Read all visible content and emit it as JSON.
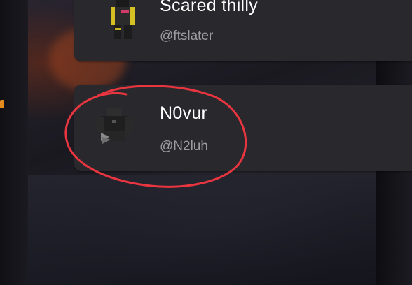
{
  "users": [
    {
      "display_name": "Scared thilly",
      "handle": "@ftslater",
      "avatar_icon": "avatar-figure-icon"
    },
    {
      "display_name": "N0vur",
      "handle": "@N2luh",
      "avatar_icon": "avatar-figure-icon"
    }
  ],
  "colors": {
    "card_background": "#29292d",
    "name_text": "#ffffff",
    "handle_text": "#9c9ca2",
    "annotation": "#e8353f"
  }
}
